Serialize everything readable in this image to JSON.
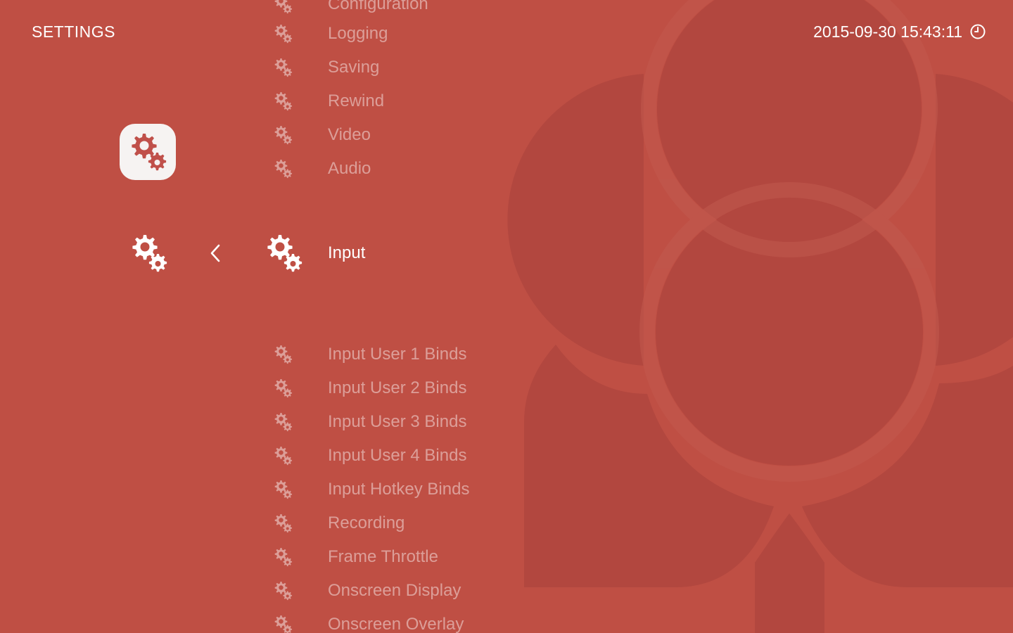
{
  "header": {
    "title": "SETTINGS",
    "datetime": "2015-09-30 15:43:11",
    "clock_icon": "clock-icon"
  },
  "sidebar": {
    "tile_icon": "settings-gears-icon",
    "lane_icon": "settings-gears-icon",
    "back_icon": "chevron-left-icon"
  },
  "menu": {
    "items_above": [
      {
        "label": "Configuration",
        "icon": "settings-gears-icon"
      },
      {
        "label": "Logging",
        "icon": "settings-gears-icon"
      },
      {
        "label": "Saving",
        "icon": "settings-gears-icon"
      },
      {
        "label": "Rewind",
        "icon": "settings-gears-icon"
      },
      {
        "label": "Video",
        "icon": "settings-gears-icon"
      },
      {
        "label": "Audio",
        "icon": "settings-gears-icon"
      }
    ],
    "selected": {
      "label": "Input",
      "icon": "settings-gears-icon"
    },
    "items_below": [
      {
        "label": "Input User 1 Binds",
        "icon": "settings-gears-icon"
      },
      {
        "label": "Input User 2 Binds",
        "icon": "settings-gears-icon"
      },
      {
        "label": "Input User 3 Binds",
        "icon": "settings-gears-icon"
      },
      {
        "label": "Input User 4 Binds",
        "icon": "settings-gears-icon"
      },
      {
        "label": "Input Hotkey Binds",
        "icon": "settings-gears-icon"
      },
      {
        "label": "Recording",
        "icon": "settings-gears-icon"
      },
      {
        "label": "Frame Throttle",
        "icon": "settings-gears-icon"
      },
      {
        "label": "Onscreen Display",
        "icon": "settings-gears-icon"
      },
      {
        "label": "Onscreen Overlay",
        "icon": "settings-gears-icon"
      }
    ]
  },
  "colors": {
    "background": "#bf4f44",
    "art": "#b2473f",
    "tile": "#f6f3f2",
    "text": "#ffffff"
  }
}
